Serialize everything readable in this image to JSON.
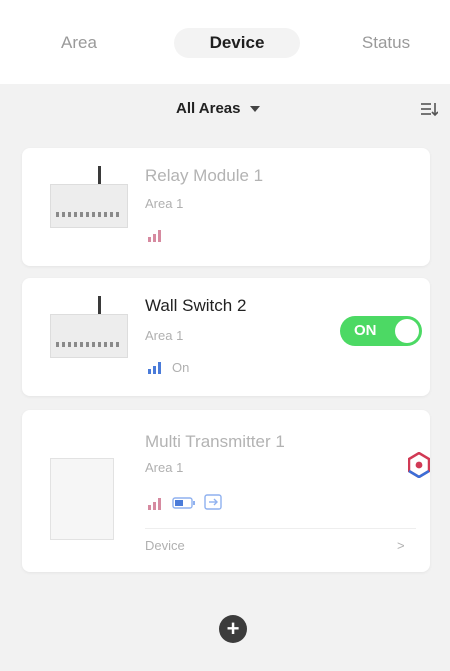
{
  "tabs": [
    {
      "label": "Area"
    },
    {
      "label": "Device"
    },
    {
      "label": "Status"
    }
  ],
  "filter": {
    "label": "All Areas"
  },
  "devices": [
    {
      "name": "Relay Module 1",
      "area": "Area 1"
    },
    {
      "name": "Wall Switch 2",
      "area": "Area 1",
      "status_text": "On",
      "toggle_label": "ON"
    },
    {
      "name": "Multi Transmitter 1",
      "area": "Area 1",
      "footer_label": "Device",
      "footer_chevron": ">"
    }
  ],
  "colors": {
    "accent_green": "#4cd964",
    "signal_red": "#d4445c",
    "signal_blue": "#4a7bd9"
  },
  "icons": {
    "sort": "sort-icon",
    "add": "plus-circle-icon",
    "logo": "app-logo-icon"
  },
  "add_button": {
    "symbol": "+"
  }
}
